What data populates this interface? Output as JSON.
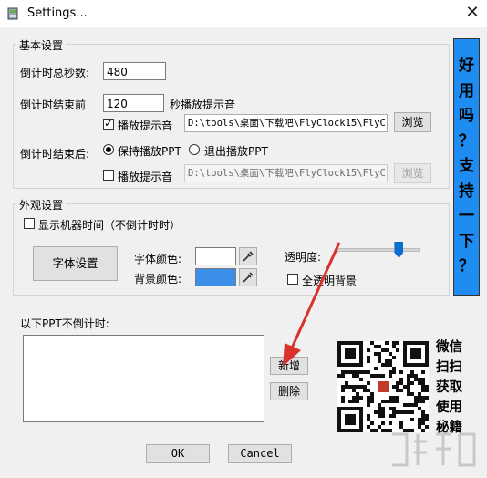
{
  "window": {
    "title": "Settings...",
    "close_glyph": "✕",
    "icon": "settings-app-icon"
  },
  "basic": {
    "group_label": "基本设置",
    "total_seconds_label": "倒计时总秒数:",
    "total_seconds_value": "480",
    "before_end_label": "倒计时结束前",
    "before_end_value": "120",
    "before_end_suffix": "秒播放提示音",
    "play_sound_1_label": "播放提示音",
    "play_sound_1_checked": true,
    "sound_path_1": "D:\\tools\\桌面\\下载吧\\FlyClock15\\FlyC",
    "browse_1": "浏览",
    "after_end_label": "倒计时结束后:",
    "keep_playing_label": "保持播放PPT",
    "exit_playing_label": "退出播放PPT",
    "play_sound_2_label": "播放提示音",
    "play_sound_2_checked": false,
    "sound_path_2": "D:\\tools\\桌面\\下载吧\\FlyClock15\\FlyC",
    "browse_2": "浏览"
  },
  "appearance": {
    "group_label": "外观设置",
    "show_machine_time_label": "显示机器时间（不倒计时时）",
    "font_button": "字体设置",
    "font_color_label": "字体颜色:",
    "font_color": "#ffffff",
    "bg_color_label": "背景颜色:",
    "bg_color": "#3b8fe8",
    "opacity_label": "透明度:",
    "opacity_value": 0.78,
    "full_transparent_label": "全透明背景"
  },
  "ppt_list": {
    "label": "以下PPT不倒计时:",
    "add_button": "新增",
    "delete_button": "删除",
    "items": []
  },
  "banner_text": [
    "好",
    "用",
    "吗",
    "？",
    "支",
    "持",
    "一",
    "下",
    "？"
  ],
  "qr_text": [
    "微信",
    "扫扫",
    "获取",
    "使用",
    "秘籍"
  ],
  "buttons": {
    "ok": "OK",
    "cancel": "Cancel"
  },
  "colors": {
    "accent_blue": "#1e8cf0",
    "arrow_red": "#d9312b"
  }
}
